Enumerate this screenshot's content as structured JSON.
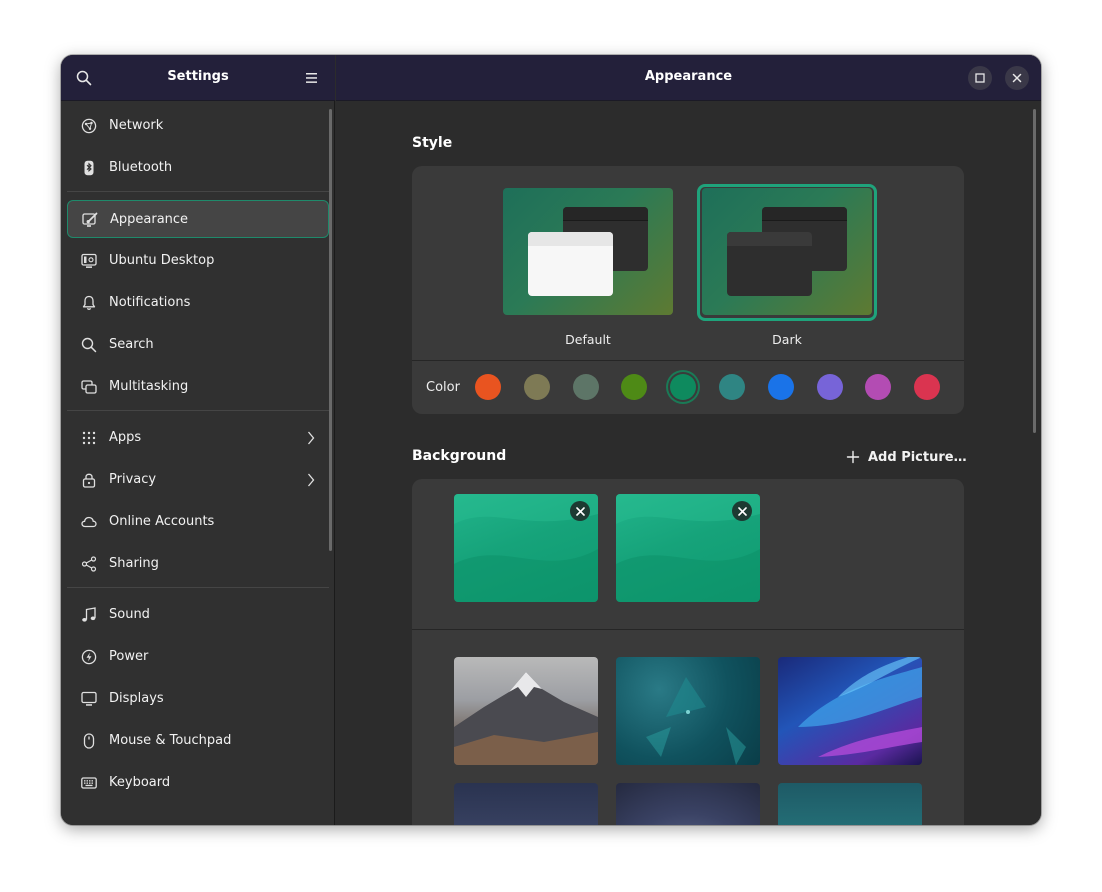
{
  "sidebar": {
    "title": "Settings",
    "groups": [
      [
        {
          "label": "Network",
          "icon": "network-icon"
        },
        {
          "label": "Bluetooth",
          "icon": "bluetooth-icon"
        }
      ],
      [
        {
          "label": "Appearance",
          "icon": "appearance-icon",
          "selected": true
        },
        {
          "label": "Ubuntu Desktop",
          "icon": "ubuntu-desktop-icon"
        },
        {
          "label": "Notifications",
          "icon": "bell-icon"
        },
        {
          "label": "Search",
          "icon": "search-icon"
        },
        {
          "label": "Multitasking",
          "icon": "multitasking-icon"
        }
      ],
      [
        {
          "label": "Apps",
          "icon": "apps-grid-icon",
          "chevron": true
        },
        {
          "label": "Privacy",
          "icon": "lock-icon",
          "chevron": true
        },
        {
          "label": "Online Accounts",
          "icon": "cloud-icon"
        },
        {
          "label": "Sharing",
          "icon": "share-icon"
        }
      ],
      [
        {
          "label": "Sound",
          "icon": "music-note-icon"
        },
        {
          "label": "Power",
          "icon": "power-icon"
        },
        {
          "label": "Displays",
          "icon": "display-icon"
        },
        {
          "label": "Mouse & Touchpad",
          "icon": "mouse-icon"
        },
        {
          "label": "Keyboard",
          "icon": "keyboard-icon"
        }
      ]
    ]
  },
  "main": {
    "title": "Appearance",
    "style": {
      "heading": "Style",
      "options": [
        {
          "label": "Default",
          "selected": false
        },
        {
          "label": "Dark",
          "selected": true
        }
      ],
      "color_label": "Color",
      "colors": [
        "#e95420",
        "#7e7a55",
        "#5d7567",
        "#4e8a16",
        "#0e8a5e",
        "#2f8583",
        "#1a73e8",
        "#7764d8",
        "#b34cb3",
        "#da3450"
      ],
      "selected_color_index": 4
    },
    "background": {
      "heading": "Background",
      "add_label": "Add Picture…"
    }
  },
  "colors": {
    "accent": "#1fa37b",
    "header": "#23203a",
    "sidebar": "#303030",
    "content": "#2c2c2c",
    "card": "#3a3a3a"
  }
}
